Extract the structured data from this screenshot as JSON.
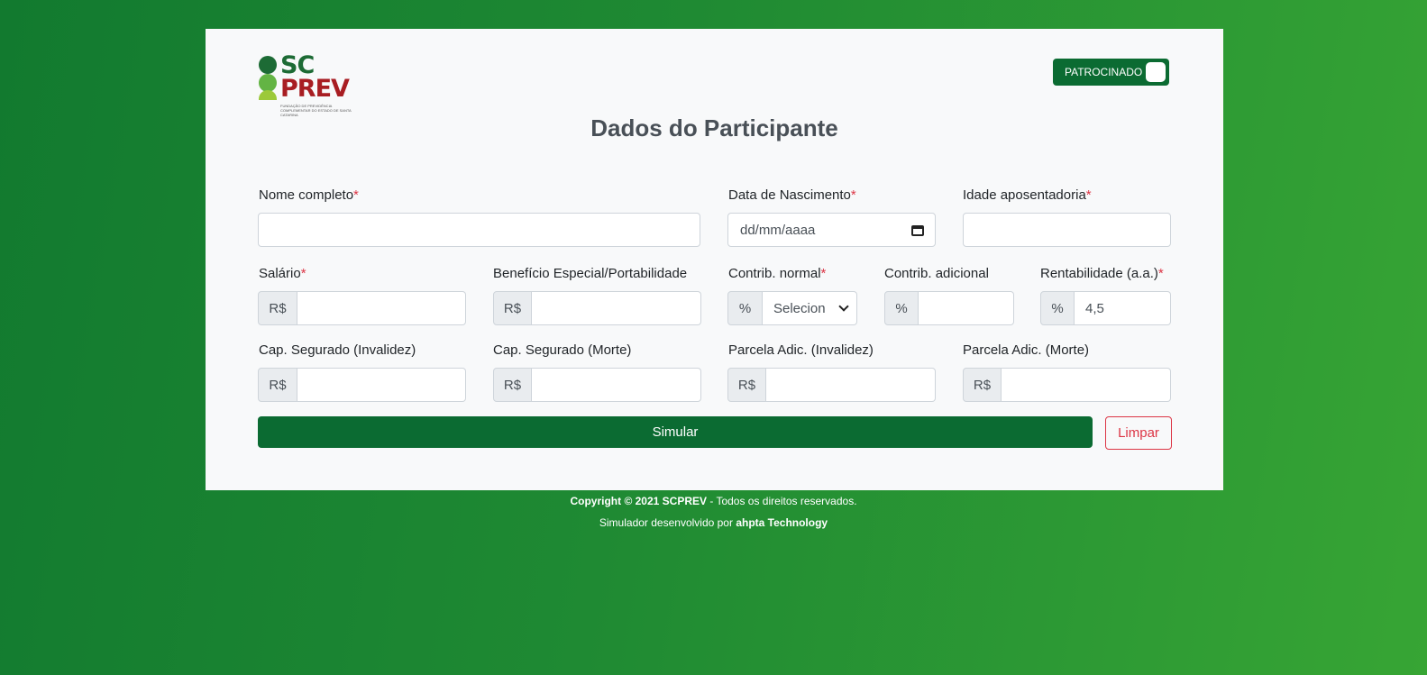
{
  "header": {
    "logo_line1": "SC",
    "logo_line2": "PREV",
    "logo_tagline": "FUNDAÇÃO DE PREVIDÊNCIA COMPLEMENTAR DO ESTADO DE SANTA CATARINA",
    "toggle_label": "PATROCINADO"
  },
  "title": "Dados do Participante",
  "required_mark": "*",
  "fields": {
    "nome": {
      "label": "Nome completo",
      "value": ""
    },
    "nascimento": {
      "label": "Data de Nascimento",
      "placeholder": "dd/mm/aaaa"
    },
    "idade": {
      "label": "Idade aposentadoria",
      "value": ""
    },
    "salario": {
      "label": "Salário",
      "prefix": "R$",
      "value": ""
    },
    "beneficio": {
      "label": "Benefício Especial/Portabilidade",
      "prefix": "R$",
      "value": ""
    },
    "contrib_normal": {
      "label": "Contrib. normal",
      "prefix": "%",
      "selected": "Selecion"
    },
    "contrib_adicional": {
      "label": "Contrib. adicional",
      "prefix": "%",
      "value": ""
    },
    "rentabilidade": {
      "label": "Rentabilidade (a.a.)",
      "prefix": "%",
      "value": "4,5"
    },
    "cap_invalidez": {
      "label": "Cap. Segurado (Invalidez)",
      "prefix": "R$",
      "value": ""
    },
    "cap_morte": {
      "label": "Cap. Segurado (Morte)",
      "prefix": "R$",
      "value": ""
    },
    "parcela_invalidez": {
      "label": "Parcela Adic. (Invalidez)",
      "prefix": "R$",
      "value": ""
    },
    "parcela_morte": {
      "label": "Parcela Adic. (Morte)",
      "prefix": "R$",
      "value": ""
    }
  },
  "buttons": {
    "simular": "Simular",
    "limpar": "Limpar"
  },
  "footer": {
    "copyright_bold": "Copyright © 2021 SCPREV",
    "copyright_rest": " - Todos os direitos reservados.",
    "dev_prefix": "Simulador desenvolvido por ",
    "dev_name": "ahpta Technology"
  },
  "colors": {
    "brand_green": "#0b6b32",
    "danger": "#dc3545",
    "logo_red": "#a81d22"
  }
}
